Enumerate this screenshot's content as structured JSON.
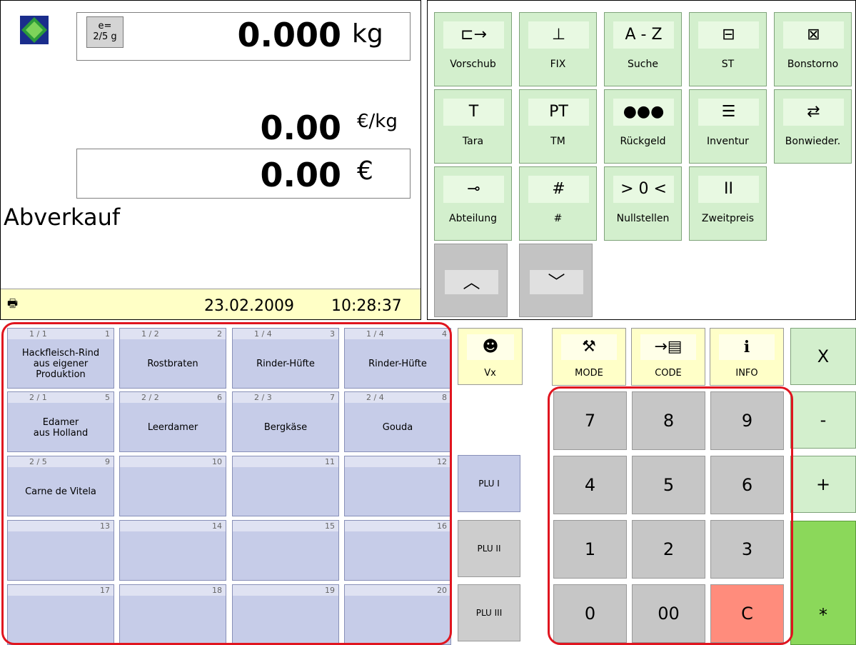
{
  "display": {
    "e_value_line1": "e=",
    "e_value_line2": "2/5 g",
    "weight": "0.000",
    "weight_unit": "kg",
    "price_per_kg": "0.00",
    "price_per_kg_unit": "€/kg",
    "total": "0.00",
    "total_unit": "€",
    "mode": "Abverkauf",
    "date": "23.02.2009",
    "time": "10:28:37"
  },
  "function_keys": [
    {
      "label": "Vorschub",
      "icon": "feed-icon",
      "glyph": "⊏→"
    },
    {
      "label": "FIX",
      "icon": "pin-icon",
      "glyph": "⊥"
    },
    {
      "label": "Suche",
      "icon": "search-az-icon",
      "glyph": "A - Z"
    },
    {
      "label": "ST",
      "icon": "receipt-icon",
      "glyph": "⊟"
    },
    {
      "label": "Bonstorno",
      "icon": "cancel-receipt-icon",
      "glyph": "⊠"
    },
    {
      "label": "Tara",
      "icon": "tare-icon",
      "glyph": "T"
    },
    {
      "label": "TM",
      "icon": "tare-memory-icon",
      "glyph": "PT"
    },
    {
      "label": "Rückgeld",
      "icon": "coins-icon",
      "glyph": "●●●"
    },
    {
      "label": "Inventur",
      "icon": "inventory-icon",
      "glyph": "☰"
    },
    {
      "label": "Bonwieder.",
      "icon": "reprint-icon",
      "glyph": "⇄"
    },
    {
      "label": "Abteilung",
      "icon": "department-icon",
      "glyph": "⊸"
    },
    {
      "label": "#",
      "icon": "hash-icon",
      "glyph": "#"
    },
    {
      "label": "Nullstellen",
      "icon": "zero-icon",
      "glyph": "> 0 <"
    },
    {
      "label": "Zweitpreis",
      "icon": "second-price-icon",
      "glyph": "II"
    }
  ],
  "scroll": {
    "up": "︿",
    "down": "﹀"
  },
  "plu": [
    {
      "pos": "1 / 1",
      "num": "1",
      "name": "Hackfleisch-Rind\naus eigener\nProduktion"
    },
    {
      "pos": "1 / 2",
      "num": "2",
      "name": "Rostbraten"
    },
    {
      "pos": "1 / 4",
      "num": "3",
      "name": "Rinder-Hüfte"
    },
    {
      "pos": "1 / 4",
      "num": "4",
      "name": "Rinder-Hüfte"
    },
    {
      "pos": "2 / 1",
      "num": "5",
      "name": "Edamer\naus Holland"
    },
    {
      "pos": "2 / 2",
      "num": "6",
      "name": "Leerdamer"
    },
    {
      "pos": "2 / 3",
      "num": "7",
      "name": "Bergkäse"
    },
    {
      "pos": "2 / 4",
      "num": "8",
      "name": "Gouda"
    },
    {
      "pos": "2 / 5",
      "num": "9",
      "name": "Carne de Vitela"
    },
    {
      "pos": "",
      "num": "10",
      "name": ""
    },
    {
      "pos": "",
      "num": "11",
      "name": ""
    },
    {
      "pos": "",
      "num": "12",
      "name": ""
    },
    {
      "pos": "",
      "num": "13",
      "name": ""
    },
    {
      "pos": "",
      "num": "14",
      "name": ""
    },
    {
      "pos": "",
      "num": "15",
      "name": ""
    },
    {
      "pos": "",
      "num": "16",
      "name": ""
    },
    {
      "pos": "",
      "num": "17",
      "name": ""
    },
    {
      "pos": "",
      "num": "18",
      "name": ""
    },
    {
      "pos": "",
      "num": "19",
      "name": ""
    },
    {
      "pos": "",
      "num": "20",
      "name": ""
    }
  ],
  "plu_levels": [
    "PLU I",
    "PLU II",
    "PLU III"
  ],
  "service_keys": [
    {
      "label": "Vx",
      "icon": "operator-icon",
      "glyph": "☻"
    },
    {
      "label": "MODE",
      "icon": "wrench-icon",
      "glyph": "⚒"
    },
    {
      "label": "CODE",
      "icon": "code-icon",
      "glyph": "→▤"
    },
    {
      "label": "INFO",
      "icon": "info-icon",
      "glyph": "i"
    }
  ],
  "numpad": [
    "7",
    "8",
    "9",
    "4",
    "5",
    "6",
    "1",
    "2",
    "3",
    "0",
    "00",
    "C"
  ],
  "operators": {
    "multiply": "X",
    "minus": "-",
    "plus": "+",
    "enter": "*"
  }
}
